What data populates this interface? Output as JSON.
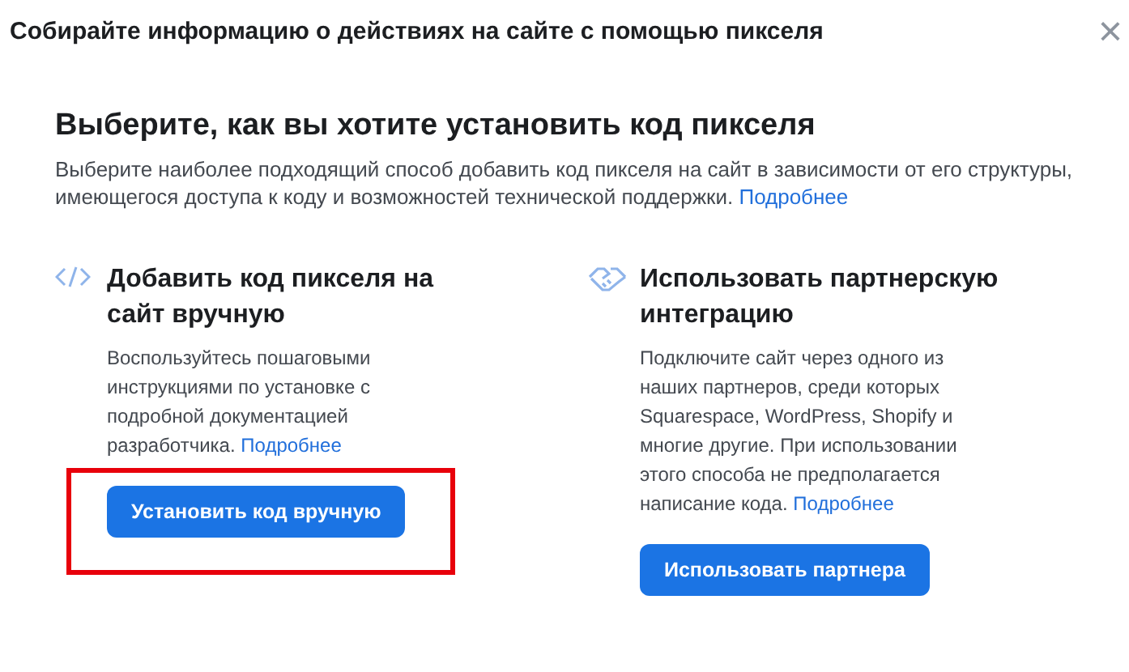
{
  "dialog": {
    "title": "Собирайте информацию о действиях на сайте с помощью пикселя",
    "close": "×"
  },
  "heading": "Выберите, как вы хотите установить код пикселя",
  "description": "Выберите наиболее подходящий способ добавить код пикселя на сайт в зависимости от его структуры, имеющегося доступа к коду и возможностей технической поддержки.",
  "description_link": "Подробнее",
  "options": [
    {
      "kind": "code",
      "title": "Добавить код пикселя на сайт вручную",
      "text": "Воспользуйтесь пошаговыми инструкциями по установке с подробной документацией разработчика.",
      "link": "Подробнее",
      "button": "Установить код вручную",
      "highlighted": true
    },
    {
      "kind": "partner",
      "title": "Использовать партнерскую интеграцию",
      "text": "Подключите сайт через одного из наших партнеров, среди которых Squarespace, WordPress, Shopify и многие другие. При использовании этого способа не предполагается написание кода.",
      "link": "Подробнее",
      "button": "Использовать партнера",
      "highlighted": false
    }
  ]
}
